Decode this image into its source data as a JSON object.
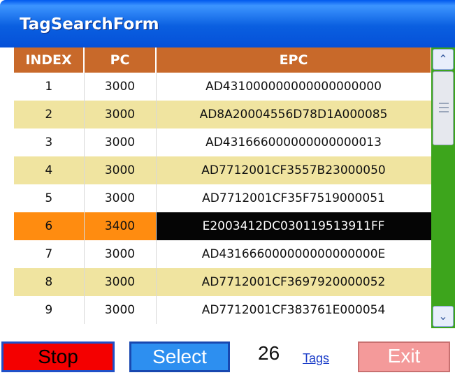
{
  "window": {
    "title": "TagSearchForm"
  },
  "grid": {
    "columns": [
      "INDEX",
      "PC",
      "EPC"
    ],
    "rows": [
      {
        "index": "1",
        "pc": "3000",
        "epc": "AD431000000000000000000"
      },
      {
        "index": "2",
        "pc": "3000",
        "epc": "AD8A20004556D78D1A000085"
      },
      {
        "index": "3",
        "pc": "3000",
        "epc": "AD431666000000000000013"
      },
      {
        "index": "4",
        "pc": "3000",
        "epc": "AD7712001CF3557B23000050"
      },
      {
        "index": "5",
        "pc": "3000",
        "epc": "AD7712001CF35F7519000051"
      },
      {
        "index": "6",
        "pc": "3400",
        "epc": "E2003412DC030119513911FF"
      },
      {
        "index": "7",
        "pc": "3000",
        "epc": "AD431666000000000000000E"
      },
      {
        "index": "8",
        "pc": "3000",
        "epc": "AD7712001CF3697920000052"
      },
      {
        "index": "9",
        "pc": "3000",
        "epc": "AD7712001CF383761E000054"
      }
    ],
    "selected_index": "6"
  },
  "scrollbar": {
    "up_icon": "chevron-up-icon",
    "down_icon": "chevron-down-icon",
    "up_glyph": "⌃",
    "down_glyph": "⌄"
  },
  "footer": {
    "stop_label": "Stop",
    "select_label": "Select",
    "tag_count": "26",
    "tags_label": "Tags",
    "exit_label": "Exit"
  },
  "colors": {
    "title_bar": "#0a5fe0",
    "header": "#c8692a",
    "row_alt": "#f0e4a0",
    "selected_row": "#ff8c10",
    "selected_epc": "#050505",
    "scrollbar_track": "#3da51c",
    "stop_button": "#f40000",
    "select_button": "#2d8ff0",
    "exit_button": "#f49a9a"
  }
}
